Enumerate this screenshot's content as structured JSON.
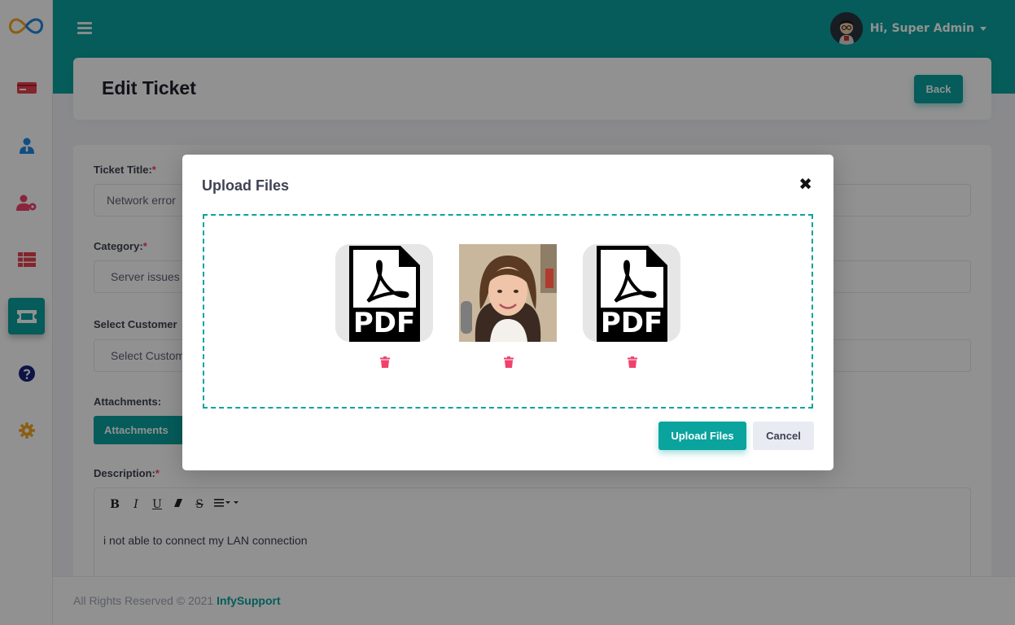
{
  "app": {
    "name": "InfySupport"
  },
  "colors": {
    "accent": "#0aa39e",
    "danger": "#f1416c"
  },
  "sidebar": {
    "items": [
      {
        "name": "dashboard",
        "icon": "card-icon",
        "color": "#e8414e"
      },
      {
        "name": "agents",
        "icon": "user-tie-icon",
        "color": "#1e88e5"
      },
      {
        "name": "customers",
        "icon": "user-cog-icon",
        "color": "#f1416c"
      },
      {
        "name": "categories",
        "icon": "table-list-icon",
        "color": "#e8414e"
      },
      {
        "name": "tickets",
        "icon": "ticket-icon",
        "color": "#ffffff",
        "active": true
      },
      {
        "name": "faqs",
        "icon": "question-circle-icon",
        "color": "#1a237e"
      },
      {
        "name": "settings",
        "icon": "gear-icon",
        "color": "#f5a623"
      }
    ]
  },
  "header": {
    "user_greeting": "Hi, Super Admin"
  },
  "page": {
    "title": "Edit Ticket",
    "back_label": "Back"
  },
  "form": {
    "title_label": "Ticket Title:",
    "title_value": "Network error",
    "category_label": "Category:",
    "category_value": "Server issues",
    "customer_label": "Select Customer",
    "customer_value": "Select Customer",
    "attachments_label": "Attachments:",
    "attachments_button": "Attachments",
    "description_label": "Description:",
    "description_value": "i not able to connect my LAN connection",
    "required_mark": "*",
    "toolbar": {
      "bold": "B",
      "italic": "I",
      "underline": "U",
      "strike": "S"
    }
  },
  "modal": {
    "title": "Upload Files",
    "close_symbol": "✖",
    "files": [
      {
        "type": "pdf",
        "icon": "pdf-file-icon",
        "label": "PDF"
      },
      {
        "type": "image",
        "icon": "photo-thumbnail"
      },
      {
        "type": "pdf",
        "icon": "pdf-file-icon",
        "label": "PDF"
      }
    ],
    "upload_label": "Upload Files",
    "cancel_label": "Cancel"
  },
  "footer": {
    "text": "All Rights Reserved © 2021 ",
    "link": "InfySupport"
  }
}
